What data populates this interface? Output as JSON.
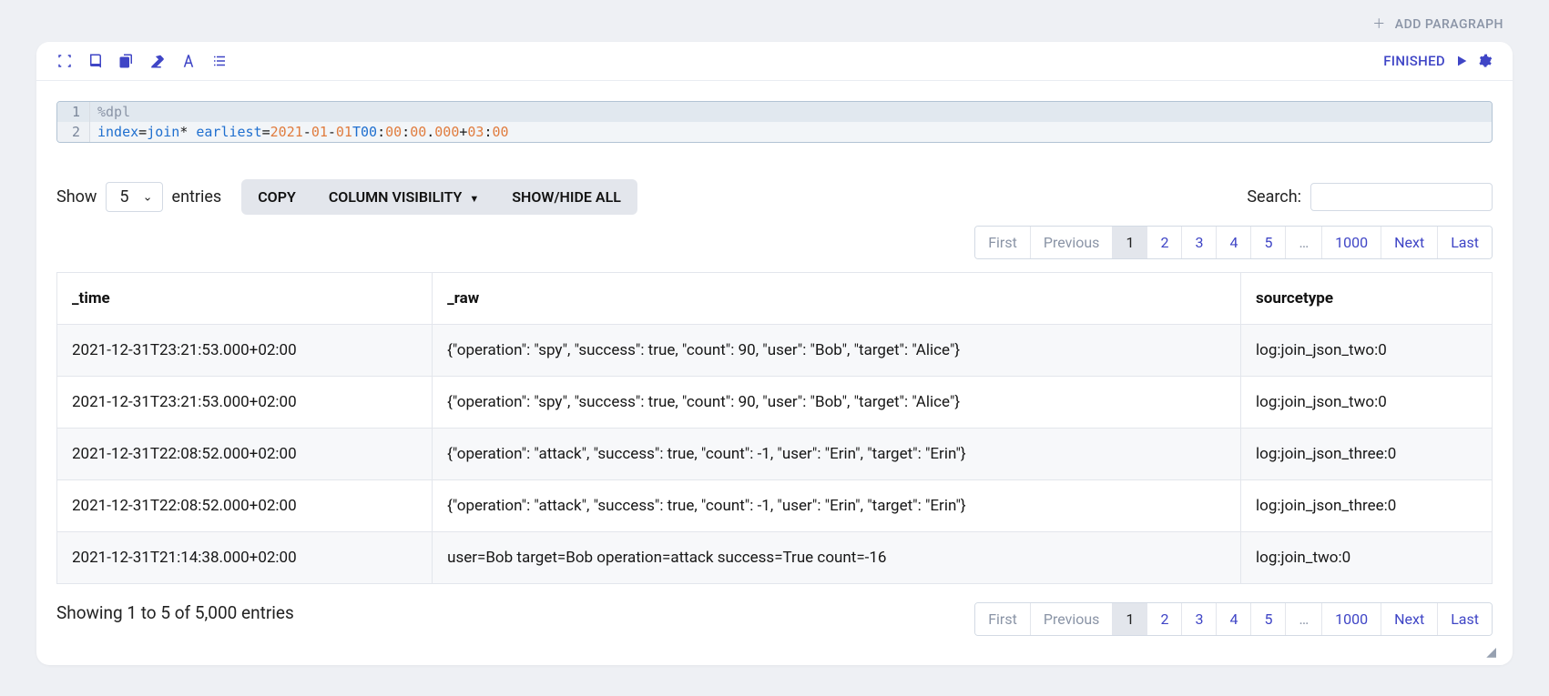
{
  "header": {
    "add_paragraph_label": "ADD PARAGRAPH"
  },
  "toolbar": {
    "status": "FINISHED"
  },
  "code": {
    "line1": {
      "num": "1",
      "content": "%dpl"
    },
    "line2": {
      "num": "2",
      "k_index": "index",
      "eq1": "=",
      "v_join": "join",
      "star": "* ",
      "k_earliest": "earliest",
      "eq2": "=",
      "v_year": "2021",
      "dash1": "-",
      "v_month": "01",
      "dash2": "-",
      "v_day": "01",
      "t": "T00",
      "c1": ":",
      "h": "00",
      "c2": ":",
      "m": "00",
      "dot": ".",
      "ms": "000",
      "plus": "+",
      "tz1": "03",
      "c3": ":",
      "tz2": "00"
    }
  },
  "controls": {
    "show_label": "Show",
    "entries_label": "entries",
    "page_size": "5",
    "copy_btn": "COPY",
    "colvis_btn": "COLUMN VISIBILITY",
    "showhide_btn": "SHOW/HIDE ALL",
    "search_label": "Search:",
    "search_value": ""
  },
  "pagination": {
    "first": "First",
    "previous": "Previous",
    "pages": [
      "1",
      "2",
      "3",
      "4",
      "5",
      "…",
      "1000"
    ],
    "active": "1",
    "next": "Next",
    "last": "Last"
  },
  "table": {
    "columns": [
      "_time",
      "_raw",
      "sourcetype"
    ],
    "rows": [
      {
        "time": "2021-12-31T23:21:53.000+02:00",
        "raw": "{\"operation\": \"spy\", \"success\": true, \"count\": 90, \"user\": \"Bob\", \"target\": \"Alice\"}",
        "sourcetype": "log:join_json_two:0"
      },
      {
        "time": "2021-12-31T23:21:53.000+02:00",
        "raw": "{\"operation\": \"spy\", \"success\": true, \"count\": 90, \"user\": \"Bob\", \"target\": \"Alice\"}",
        "sourcetype": "log:join_json_two:0"
      },
      {
        "time": "2021-12-31T22:08:52.000+02:00",
        "raw": "{\"operation\": \"attack\", \"success\": true, \"count\": -1, \"user\": \"Erin\", \"target\": \"Erin\"}",
        "sourcetype": "log:join_json_three:0"
      },
      {
        "time": "2021-12-31T22:08:52.000+02:00",
        "raw": "{\"operation\": \"attack\", \"success\": true, \"count\": -1, \"user\": \"Erin\", \"target\": \"Erin\"}",
        "sourcetype": "log:join_json_three:0"
      },
      {
        "time": "2021-12-31T21:14:38.000+02:00",
        "raw": "user=Bob target=Bob operation=attack success=True count=-16",
        "sourcetype": "log:join_two:0"
      }
    ]
  },
  "footer": {
    "info": "Showing 1 to 5 of 5,000 entries"
  }
}
